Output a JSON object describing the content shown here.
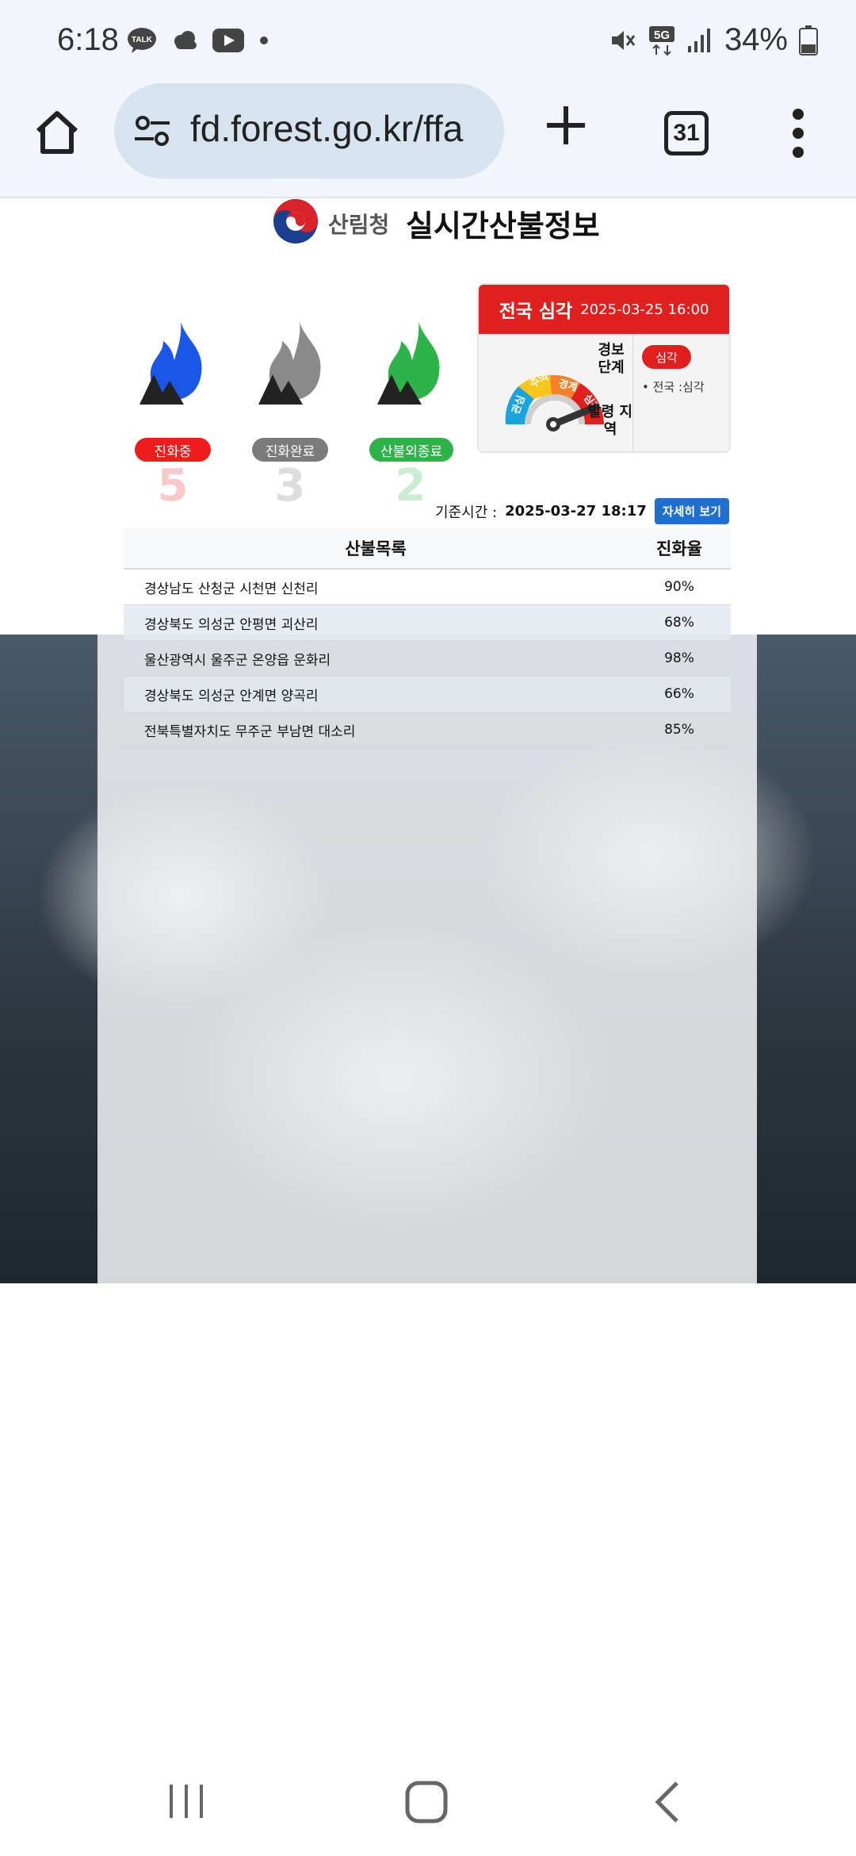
{
  "status": {
    "time": "6:18",
    "battery": "34%",
    "network": "5G"
  },
  "browser": {
    "url": "fd.forest.go.kr/ffa",
    "tab_count": "31"
  },
  "header": {
    "org_name": "산림청",
    "site_title": "실시간산불정보"
  },
  "status_counts": [
    {
      "label": "진화중",
      "count": "5",
      "color": "#ee1c1c",
      "flame_color": "#1a57e6"
    },
    {
      "label": "진화완료",
      "count": "3",
      "color": "#7b7b7b",
      "flame_color": "#8a8a8a"
    },
    {
      "label": "산불외종료",
      "count": "2",
      "color": "#2fb24a",
      "flame_color": "#2fb24a"
    }
  ],
  "alert": {
    "headline": "전국 심각",
    "datetime": "2025-03-25 16:00",
    "level_label": "경보 단계",
    "level_badge": "심각",
    "level_item": "전국 :심각",
    "gauge_labels": [
      "관심",
      "주의",
      "경계",
      "심각"
    ],
    "gauge_center": "발령 지역"
  },
  "reference": {
    "label": "기준시간 :",
    "value": "2025-03-27 18:17",
    "detail_button": "자세히 보기"
  },
  "table": {
    "col_name": "산불목록",
    "col_rate": "진화율",
    "rows": [
      {
        "name": "경상남도 산청군 시천면 신천리",
        "rate": "90%"
      },
      {
        "name": "경상북도 의성군 안평면 괴산리",
        "rate": "68%"
      },
      {
        "name": "울산광역시 울주군 온양읍 운화리",
        "rate": "98%"
      },
      {
        "name": "경상북도 의성군 안계면 양곡리",
        "rate": "66%"
      },
      {
        "name": "전북특별자치도 무주군 부남면 대소리",
        "rate": "85%"
      }
    ]
  }
}
